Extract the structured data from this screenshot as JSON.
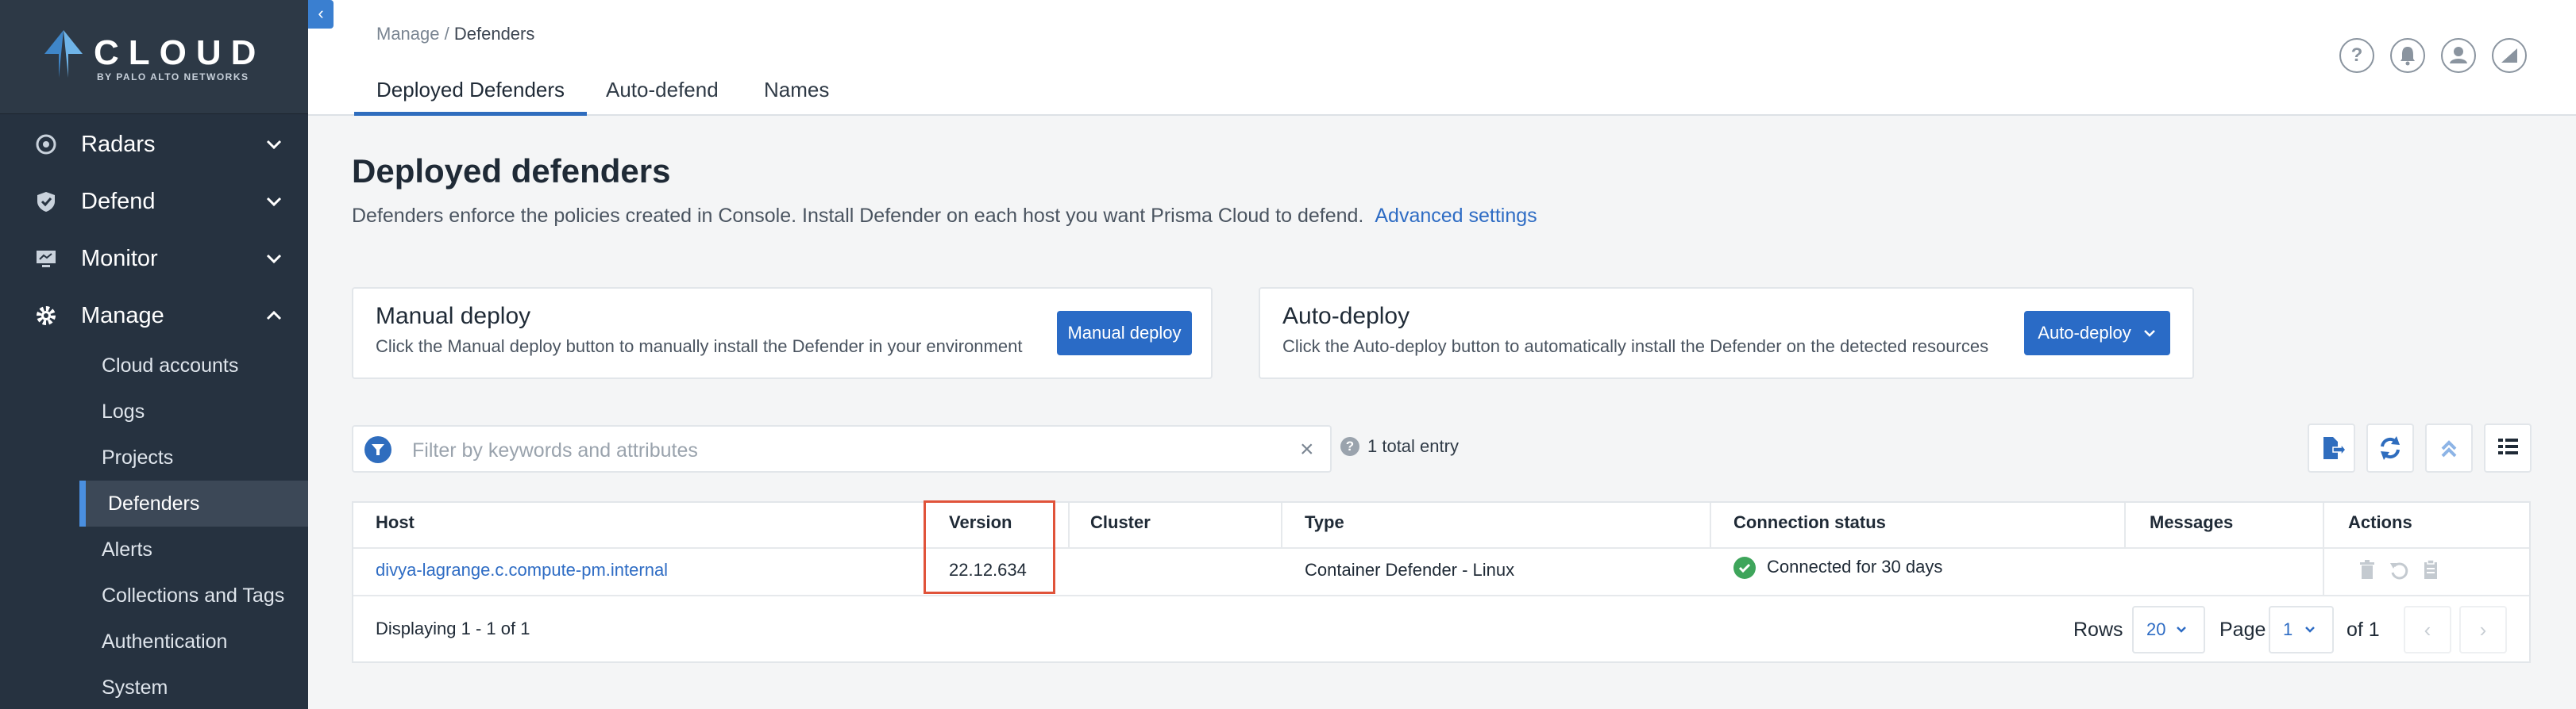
{
  "brand": {
    "name": "CLOUD",
    "sub": "BY PALO ALTO NETWORKS"
  },
  "sidebar": {
    "top_items": [
      {
        "label": "Radars",
        "icon": "radar-icon",
        "expanded": false
      },
      {
        "label": "Defend",
        "icon": "shield-icon",
        "expanded": false
      },
      {
        "label": "Monitor",
        "icon": "monitor-icon",
        "expanded": false
      },
      {
        "label": "Manage",
        "icon": "gear-icon",
        "expanded": true
      }
    ],
    "sub_items": [
      {
        "label": "Cloud accounts",
        "active": false
      },
      {
        "label": "Logs",
        "active": false
      },
      {
        "label": "Projects",
        "active": false
      },
      {
        "label": "Defenders",
        "active": true
      },
      {
        "label": "Alerts",
        "active": false
      },
      {
        "label": "Collections and Tags",
        "active": false
      },
      {
        "label": "Authentication",
        "active": false
      },
      {
        "label": "System",
        "active": false
      }
    ]
  },
  "header": {
    "breadcrumb": {
      "parent": "Manage",
      "sep": " / ",
      "current": "Defenders"
    },
    "tabs": [
      {
        "label": "Deployed Defenders",
        "active": true
      },
      {
        "label": "Auto-defend",
        "active": false
      },
      {
        "label": "Names",
        "active": false
      }
    ],
    "icons": [
      "help-icon",
      "bell-icon",
      "user-icon",
      "chart-icon"
    ]
  },
  "main": {
    "title": "Deployed defenders",
    "description": "Defenders enforce the policies created in Console. Install Defender on each host you want Prisma Cloud to defend.",
    "advanced_link": "Advanced settings",
    "manual_card": {
      "title": "Manual deploy",
      "text": "Click the Manual deploy button to manually install the Defender in your environment",
      "button": "Manual deploy"
    },
    "auto_card": {
      "title": "Auto-deploy",
      "text": "Click the Auto-deploy button to automatically install the Defender on the detected resources",
      "button": "Auto-deploy"
    },
    "filter": {
      "placeholder": "Filter by keywords and attributes"
    },
    "entries": "1 total entry",
    "toolbar_icons": [
      "export-icon",
      "refresh-icon",
      "collapse-icon",
      "columns-icon"
    ]
  },
  "table": {
    "columns": [
      "Host",
      "Version",
      "Cluster",
      "Type",
      "Connection status",
      "Messages",
      "Actions"
    ],
    "rows": [
      {
        "host": "divya-lagrange.c.compute-pm.internal",
        "version": "22.12.634",
        "cluster": "",
        "type": "Container Defender - Linux",
        "status": "Connected for 30 days",
        "messages": ""
      }
    ],
    "footer": {
      "displaying": "Displaying 1 - 1 of 1",
      "rows_label": "Rows",
      "rows_value": "20",
      "page_label": "Page",
      "page_value": "1",
      "of_label": "of 1"
    }
  },
  "colors": {
    "accent": "#2a6bc6",
    "sidebar": "#263240",
    "highlight": "#e0533a",
    "ok": "#3ea55b"
  }
}
